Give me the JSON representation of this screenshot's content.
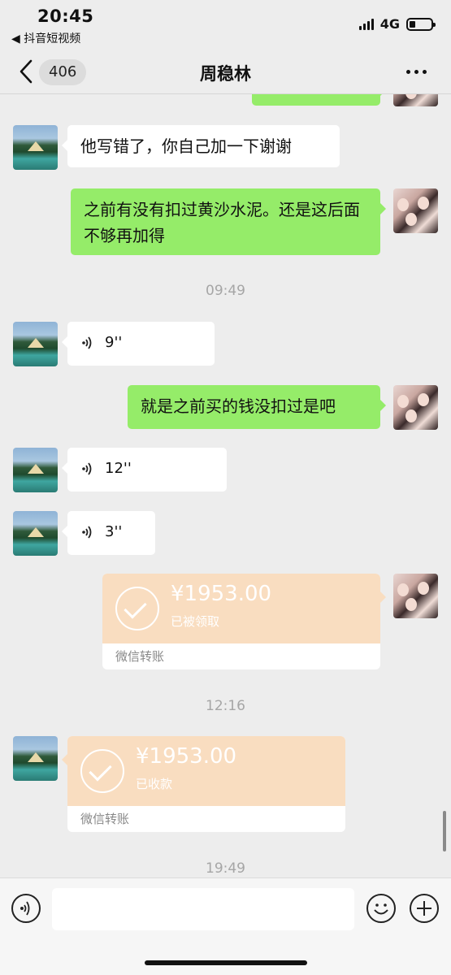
{
  "status_bar": {
    "time": "20:45",
    "back_app": "◀ 抖音短视频",
    "network": "4G"
  },
  "nav": {
    "unread_count": "406",
    "title": "周稳林"
  },
  "messages": {
    "m1_text": "他写错了，你自己加一下谢谢",
    "m2_text": "之前有没有扣过黄沙水泥。还是这后面不够再加得",
    "ts1": "09:49",
    "m3_voice": "9''",
    "m4_text": "就是之前买的钱没扣过是吧",
    "m5_voice": "12''",
    "m6_voice": "3''",
    "m7_amount": "¥1953.00",
    "m7_status": "已被领取",
    "m7_label": "微信转账",
    "ts2": "12:16",
    "m8_amount": "¥1953.00",
    "m8_status": "已收款",
    "m8_label": "微信转账",
    "ts3": "19:49"
  },
  "colors": {
    "outgoing_bubble": "#95ec69",
    "incoming_bubble": "#ffffff",
    "transfer": "#f9ddc0",
    "background": "#ededed"
  }
}
